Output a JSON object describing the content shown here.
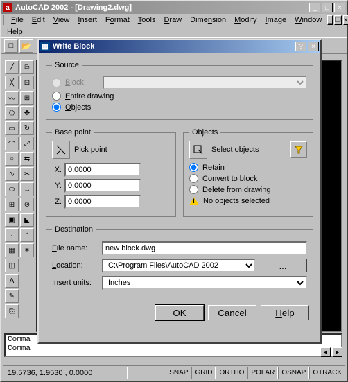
{
  "app": {
    "title": "AutoCAD 2002 - [Drawing2.dwg]",
    "menubar": [
      "File",
      "Edit",
      "View",
      "Insert",
      "Format",
      "Tools",
      "Draw",
      "Dimension",
      "Modify",
      "Image",
      "Window",
      "Help"
    ]
  },
  "command": {
    "line1": "Comma",
    "line2": "Comma"
  },
  "status": {
    "coords": "19.5736, 1.9530 , 0.0000",
    "toggles": [
      "SNAP",
      "GRID",
      "ORTHO",
      "POLAR",
      "OSNAP",
      "OTRACK"
    ]
  },
  "dialog": {
    "title": "Write Block",
    "source": {
      "legend": "Source",
      "block_label": "Block:",
      "block_value": "",
      "entire_label": "Entire drawing",
      "objects_label": "Objects",
      "selected": "objects"
    },
    "basepoint": {
      "legend": "Base point",
      "pick_label": "Pick point",
      "x": "0.0000",
      "y": "0.0000",
      "z": "0.0000",
      "xl": "X:",
      "yl": "Y:",
      "zl": "Z:"
    },
    "objects": {
      "legend": "Objects",
      "select_label": "Select objects",
      "retain": "Retain",
      "convert": "Convert to block",
      "delete": "Delete from drawing",
      "selected": "retain",
      "warn": "No objects selected"
    },
    "destination": {
      "legend": "Destination",
      "filename_label": "File name:",
      "filename": "new block.dwg",
      "location_label": "Location:",
      "location": "C:\\Program Files\\AutoCAD 2002",
      "units_label": "Insert units:",
      "units": "Inches"
    },
    "buttons": {
      "ok": "OK",
      "cancel": "Cancel",
      "help": "Help"
    }
  }
}
